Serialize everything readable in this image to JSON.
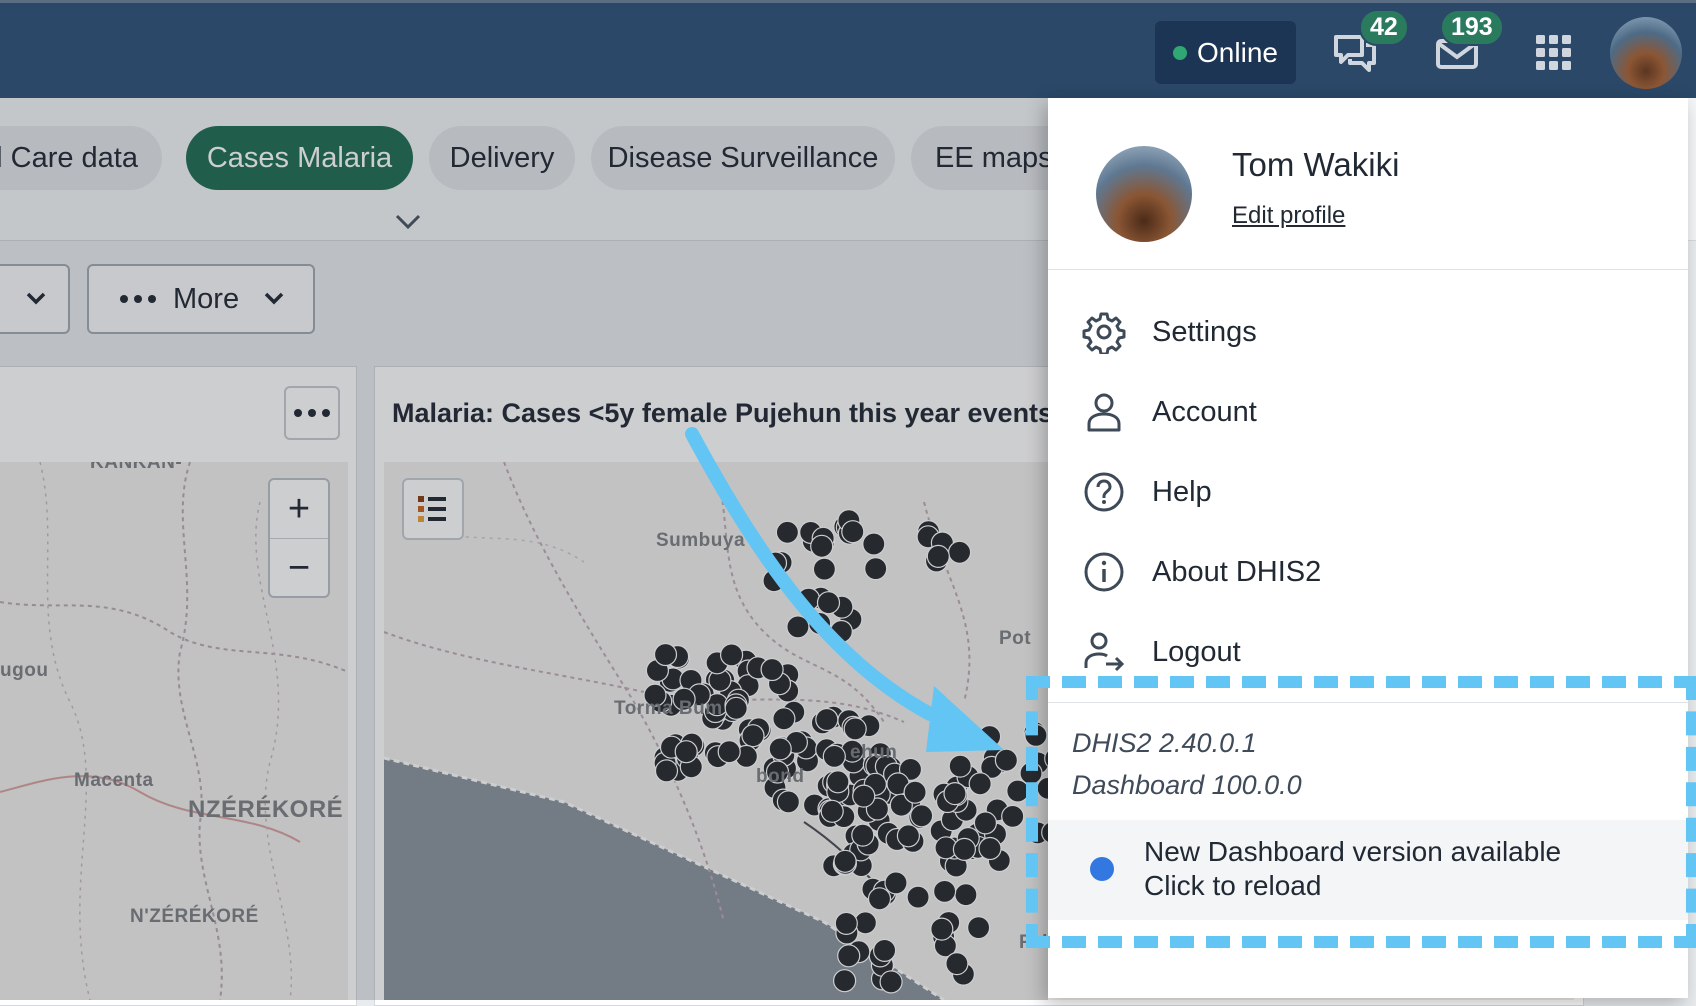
{
  "header": {
    "status_label": "Online",
    "interpretations_count": "42",
    "messages_count": "193"
  },
  "tabs": [
    {
      "label": "al Care data"
    },
    {
      "label": "Cases Malaria",
      "active": true
    },
    {
      "label": "Delivery"
    },
    {
      "label": "Disease Surveillance"
    },
    {
      "label": "EE maps"
    }
  ],
  "toolbar": {
    "more_label": "More"
  },
  "card": {
    "title": "Malaria: Cases <5y female Pujehun this year events"
  },
  "left_map_labels": {
    "kankan": "KANKAN-",
    "gugou": "ugou",
    "macenta": "Macenta",
    "nzerekore_region": "NZÉRÉKORÉ",
    "nzerekore_city": "N'ZÉRÉKORÉ"
  },
  "right_map_labels": {
    "sumbuya": "Sumbuya",
    "torma_bum": "Torma Bum",
    "pujehun": "ehun",
    "bondo": "bond",
    "pot": "Pot",
    "fairo": "Fair"
  },
  "profile_menu": {
    "user_name": "Tom Wakiki",
    "edit_profile": "Edit profile",
    "items": [
      {
        "label": "Settings",
        "icon": "gear-icon"
      },
      {
        "label": "Account",
        "icon": "person-icon"
      },
      {
        "label": "Help",
        "icon": "help-icon"
      },
      {
        "label": "About DHIS2",
        "icon": "info-icon"
      },
      {
        "label": "Logout",
        "icon": "logout-icon"
      }
    ],
    "version_dhis2": "DHIS2 2.40.0.1",
    "version_dashboard": "Dashboard 100.0.0",
    "update_line1": "New Dashboard version available",
    "update_line2": "Click to reload"
  },
  "colors": {
    "header_bg": "#2b4868",
    "active_tab": "#1f6e52",
    "badge": "#2a7a5e",
    "highlight": "#62c5f3",
    "update_dot": "#3377e0"
  }
}
